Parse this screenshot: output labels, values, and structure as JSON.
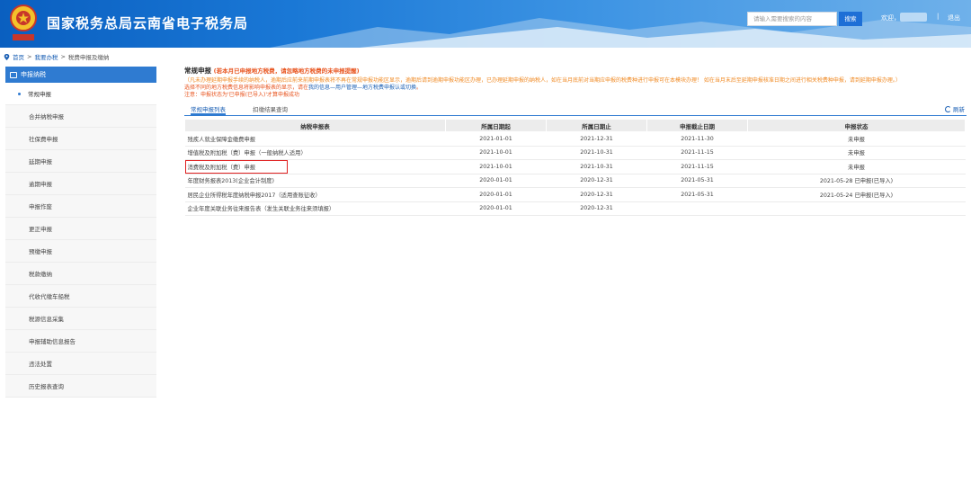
{
  "header": {
    "title": "国家税务总局云南省电子税务局",
    "search_placeholder": "请输入需要搜索的内容",
    "search_button": "搜索",
    "welcome": "欢迎，",
    "separator": "|",
    "logout": "退出"
  },
  "breadcrumb": {
    "home": "首页",
    "sep1": ">",
    "level1": "我要办税",
    "sep2": ">",
    "level2": "税费申报及缴纳"
  },
  "sidebar": {
    "header": "申报纳税",
    "items": [
      {
        "label": "常规申报",
        "active": true
      },
      {
        "label": "合并纳税申报"
      },
      {
        "label": "社保费申报"
      },
      {
        "label": "延期申报"
      },
      {
        "label": "逾期申报"
      },
      {
        "label": "申报作废"
      },
      {
        "label": "更正申报"
      },
      {
        "label": "预缴申报"
      },
      {
        "label": "税款缴纳"
      },
      {
        "label": "代收代缴车船税"
      },
      {
        "label": "税源信息采集"
      },
      {
        "label": "申报辅助信息报告"
      },
      {
        "label": "违法处置"
      },
      {
        "label": "历史报表查询"
      }
    ]
  },
  "main": {
    "title": "常规申报",
    "title_warning": "(若本月已申报地方税费，请忽略地方税费的未申报提醒)",
    "note1": "（凡未办理延期申报手续的纳税人，逾期后应前来前期申报表将不再在常规申报功能区显示，逾期后请到逾期申报功能区办理，已办理延期申报的纳税人，如在当月底前对当期应申报的税费种进行申报可在本模块办理！ 如在当月末后至延期申报核准日期之间进行相关税费种申报，请到延期申报办理。）",
    "note2_prefix": "选择不同的地方税费信息将影响申报表的显示，请在",
    "note2_link": "我的信息—用户管理—地方税费申报认或切换",
    "note2_suffix": "。",
    "note3": "注意：申报状态为'已申报(已导入)'才算申报成功",
    "tabs": [
      "常规申报列表",
      "扣缴结果查询"
    ],
    "refresh": "刷新"
  },
  "table": {
    "columns": [
      "纳税申报表",
      "所属日期起",
      "所属日期止",
      "申报截止日期",
      "申报状态"
    ],
    "rows": [
      [
        "残疾人就业保障金缴费申报",
        "2021-01-01",
        "2021-12-31",
        "2021-11-30",
        "未申报"
      ],
      [
        "增值税及附加税（费）申报（一般纳税人适用）",
        "2021-10-01",
        "2021-10-31",
        "2021-11-15",
        "未申报"
      ],
      [
        "消费税及附加税（费）申报",
        "2021-10-01",
        "2021-10-31",
        "2021-11-15",
        "未申报"
      ],
      [
        "年度财务报表2013(企业会计制度)",
        "2020-01-01",
        "2020-12-31",
        "2021-05-31",
        "2021-05-28 已申报(已导入)"
      ],
      [
        "居民企业所得税年度纳税申报2017（适用查账征收）",
        "2020-01-01",
        "2020-12-31",
        "2021-05-31",
        "2021-05-24 已申报(已导入)"
      ],
      [
        "企业年度关联业务往来报告表（发生关联业务往来须填报）",
        "2020-01-01",
        "2020-12-31",
        "",
        ""
      ]
    ],
    "highlighted_row": 2
  },
  "colors": {
    "brand_blue": "#2f7bd1",
    "warning_orange": "#e8541e",
    "highlight_red": "#e02020"
  }
}
